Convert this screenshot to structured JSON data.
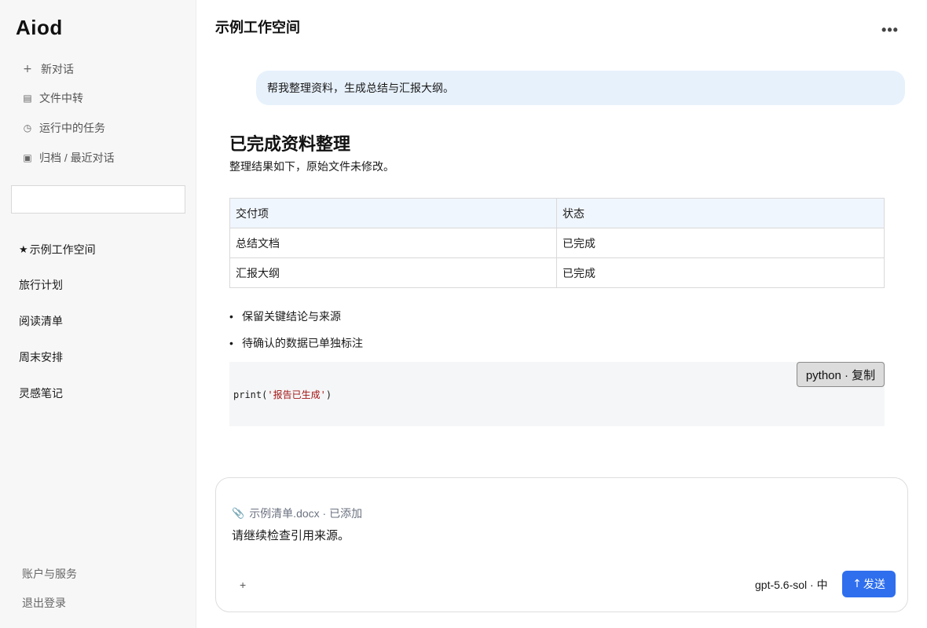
{
  "app": {
    "brand": "Aiod"
  },
  "sidebar": {
    "nav": [
      {
        "icon": "plus-icon",
        "glyph": "+",
        "label": "新对话"
      },
      {
        "icon": "document-icon",
        "glyph": "▤",
        "label": "文件中转"
      },
      {
        "icon": "clock-icon",
        "glyph": "◷",
        "label": "运行中的任务"
      },
      {
        "icon": "archive-icon",
        "glyph": "▣",
        "label": "归档 / 最近对话"
      }
    ],
    "search": {
      "value": "",
      "placeholder": ""
    },
    "conversations": [
      {
        "label": "示例工作空间",
        "starred": true,
        "star": "★"
      },
      {
        "label": "旅行计划"
      },
      {
        "label": "阅读清单"
      },
      {
        "label": "周末安排"
      },
      {
        "label": "灵感笔记"
      }
    ],
    "footer": {
      "account": "账户与服务",
      "logout": "退出登录"
    }
  },
  "header": {
    "title": "示例工作空间",
    "more": "•••"
  },
  "chat": {
    "user_message": "帮我整理资料，生成总结与汇报大纲。",
    "response": {
      "title": "已完成资料整理",
      "subtitle": "整理结果如下，原始文件未修改。",
      "table": {
        "headers": [
          "交付项",
          "状态"
        ],
        "rows": [
          [
            "总结文档",
            "已完成"
          ],
          [
            "汇报大纲",
            "已完成"
          ]
        ]
      },
      "bullets": [
        "保留关键结论与来源",
        "待确认的数据已单独标注"
      ],
      "code": {
        "fn": "print(",
        "string": "'报告已生成'",
        "close": ")",
        "copy_label": "python · 复制"
      }
    }
  },
  "composer": {
    "attachment": "示例清单.docx · 已添加",
    "attachment_icon": "📎",
    "text": "请继续检查引用来源。",
    "add": "+",
    "model": "gpt-5.6-sol · 中",
    "send_arrow": "↑",
    "send_label": "发送"
  },
  "colors": {
    "accent": "#2f6fee",
    "bubble": "#e7f1fc",
    "table_header": "#f0f6fd",
    "sidebar_bg": "#f7f7f7"
  }
}
